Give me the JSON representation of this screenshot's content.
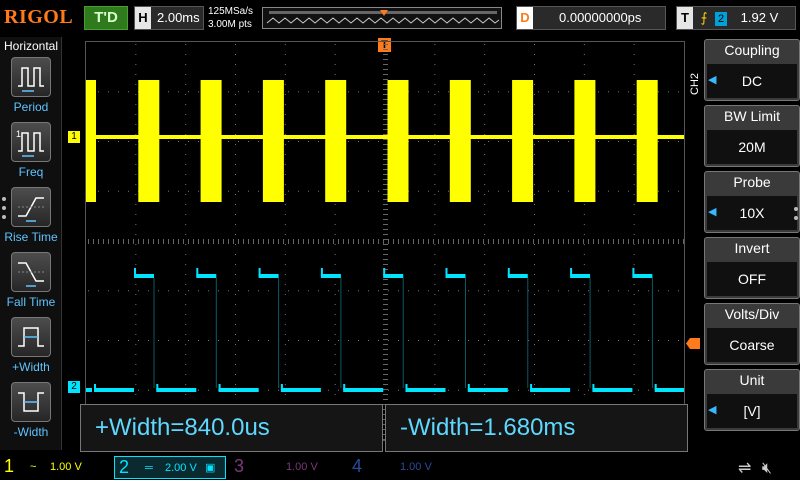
{
  "brand": "RIGOL",
  "run_status": "T'D",
  "horizontal": {
    "key": "H",
    "timebase": "2.00ms",
    "sample_rate": "125MSa/s",
    "memory_depth": "3.00M pts"
  },
  "delay": {
    "key": "D",
    "value": "0.00000000ps"
  },
  "trigger": {
    "key": "T",
    "slope_symbol": "⨍",
    "source": "2",
    "level": "1.92 V"
  },
  "left_panel": {
    "title": "Horizontal",
    "items": [
      {
        "label": "Period",
        "icon": "period-icon"
      },
      {
        "label": "Freq",
        "icon": "freq-icon"
      },
      {
        "label": "Rise Time",
        "icon": "rise-time-icon"
      },
      {
        "label": "Fall Time",
        "icon": "fall-time-icon"
      },
      {
        "label": "+Width",
        "icon": "positive-width-icon"
      },
      {
        "label": "-Width",
        "icon": "negative-width-icon"
      }
    ]
  },
  "right_menu": {
    "channel_tag": "CH2",
    "items": [
      {
        "title": "Coupling",
        "value": "DC",
        "arrow": true
      },
      {
        "title": "BW Limit",
        "value": "20M",
        "arrow": false
      },
      {
        "title": "Probe",
        "value": "10X",
        "arrow": true
      },
      {
        "title": "Invert",
        "value": "OFF",
        "arrow": false
      },
      {
        "title": "Volts/Div",
        "value": "Coarse",
        "arrow": false
      },
      {
        "title": "Unit",
        "value": "[V]",
        "arrow": true
      }
    ]
  },
  "measurements": {
    "positive_width": "+Width=840.0us",
    "negative_width": "-Width=1.680ms"
  },
  "markers": {
    "ch1": "1",
    "ch2": "2",
    "trigger_pos": "T"
  },
  "channels": [
    {
      "num": "1",
      "coupling": "~",
      "scale": "1.00 V",
      "color": "#ffff00",
      "active": false
    },
    {
      "num": "2",
      "coupling": "═",
      "scale": "2.00 V",
      "color": "#00e5ff",
      "active": true
    },
    {
      "num": "3",
      "coupling": "",
      "scale": "1.00 V",
      "color": "#a040a0",
      "active": false
    },
    {
      "num": "4",
      "coupling": "",
      "scale": "1.00 V",
      "color": "#3060d0",
      "active": false
    }
  ],
  "colors": {
    "ch1": "#ffff00",
    "ch2": "#00e5ff",
    "accent": "#ff7a1a",
    "menu_arrow": "#3ab8ff"
  },
  "waveform": {
    "ch1_pulse_count": 10,
    "ch2_pulse_count": 10
  }
}
